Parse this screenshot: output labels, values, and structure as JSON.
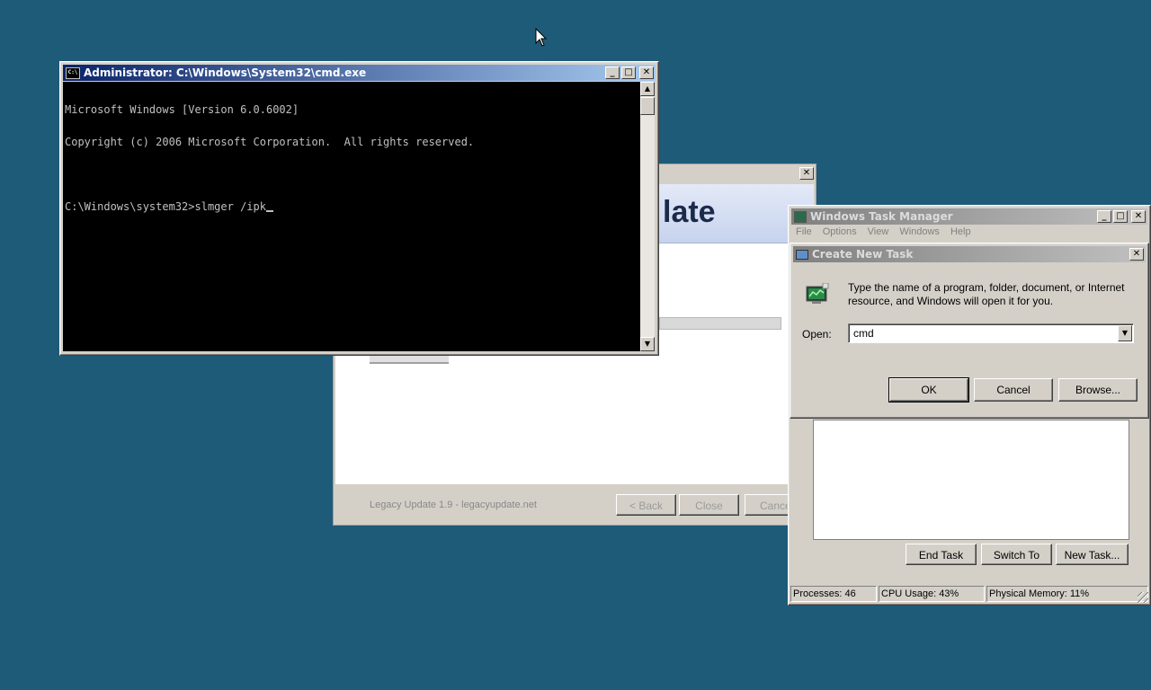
{
  "legacy": {
    "heading_fragment": "late",
    "footer_text": "Legacy Update 1.9 - legacyupdate.net",
    "back_label": "< Back",
    "close_label": "Close",
    "cancel_label": "Cance"
  },
  "cmd": {
    "title": "Administrator: C:\\Windows\\System32\\cmd.exe",
    "lines": [
      "Microsoft Windows [Version 6.0.6002]",
      "Copyright (c) 2006 Microsoft Corporation.  All rights reserved.",
      "",
      "C:\\Windows\\system32>slmger /ipk"
    ]
  },
  "taskmgr": {
    "title": "Windows Task Manager",
    "menu": [
      "File",
      "Options",
      "View",
      "Windows",
      "Help"
    ],
    "end_task": "End Task",
    "switch_to": "Switch To",
    "new_task": "New Task...",
    "status": {
      "processes": "Processes: 46",
      "cpu": "CPU Usage: 43%",
      "memory": "Physical Memory: 11%"
    }
  },
  "run": {
    "title": "Create New Task",
    "description": "Type the name of a program, folder, document, or Internet resource, and Windows will open it for you.",
    "open_label": "Open:",
    "open_value": "cmd",
    "ok": "OK",
    "cancel": "Cancel",
    "browse": "Browse..."
  }
}
